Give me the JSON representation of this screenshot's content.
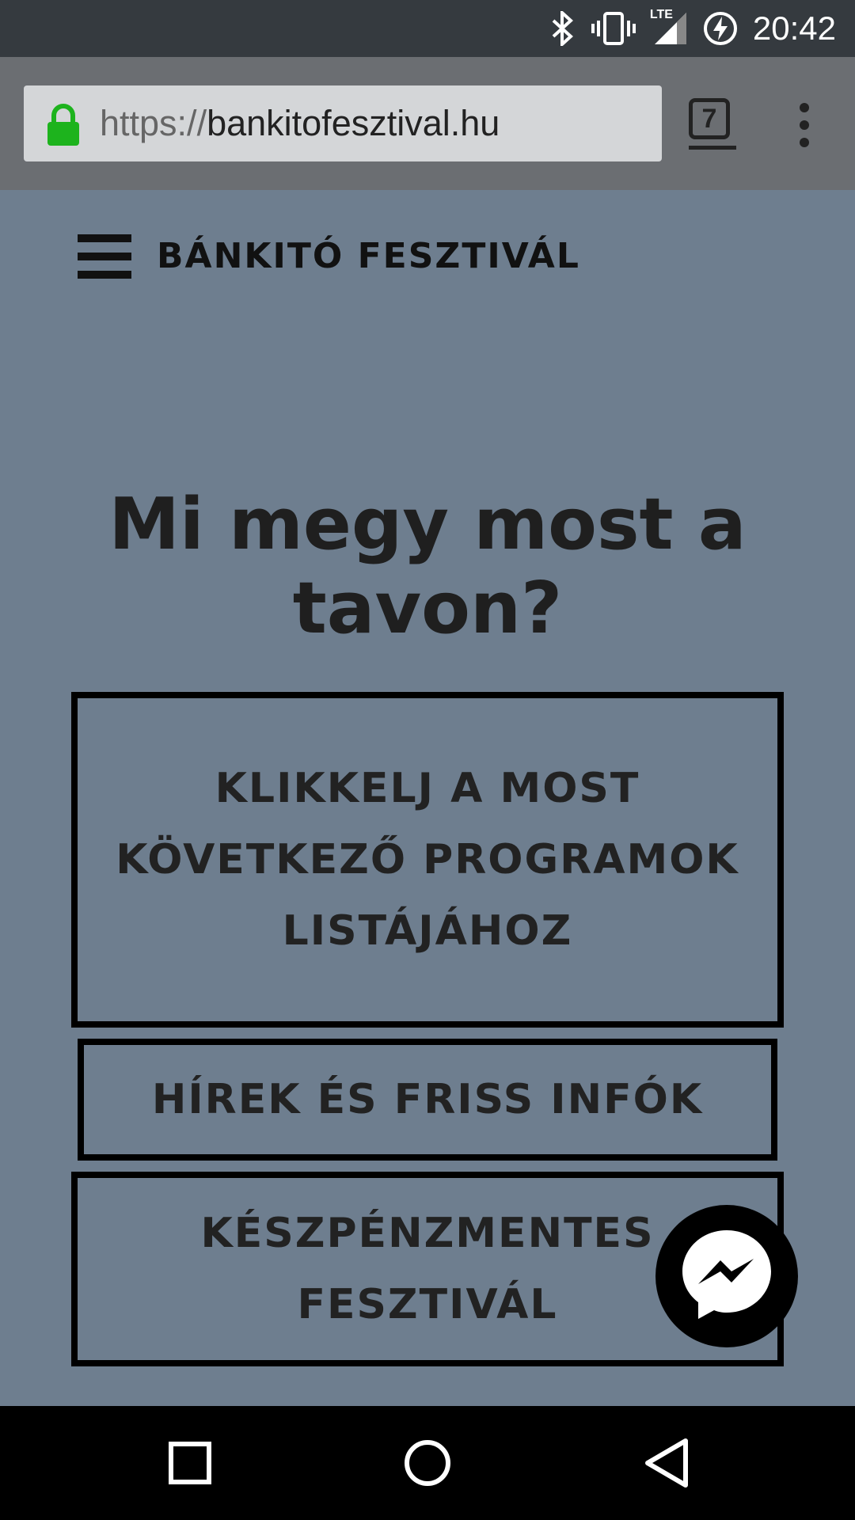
{
  "status_bar": {
    "time": "20:42",
    "network": "LTE",
    "icons": [
      "bluetooth-icon",
      "vibrate-icon",
      "signal-icon",
      "battery-charging-icon"
    ]
  },
  "browser": {
    "url_protocol": "https://",
    "url_host": "bankitofesztival.hu",
    "tab_count": "7",
    "secure": true,
    "lock_color": "#1db31d"
  },
  "header": {
    "site_title": "BÁNKITÓ FESZTIVÁL"
  },
  "main": {
    "headline": "Mi megy most a tavon?",
    "buttons": [
      {
        "label": "KLIKKELJ A MOST KÖVETKEZŐ PROGRAMOK LISTÁJÁHOZ"
      },
      {
        "label": "HÍREK ÉS FRISS INFÓK"
      },
      {
        "label": "KÉSZPÉNZMENTES FESZTIVÁL"
      }
    ]
  },
  "nav": {
    "icons": [
      "recents-icon",
      "home-icon",
      "back-icon"
    ]
  }
}
